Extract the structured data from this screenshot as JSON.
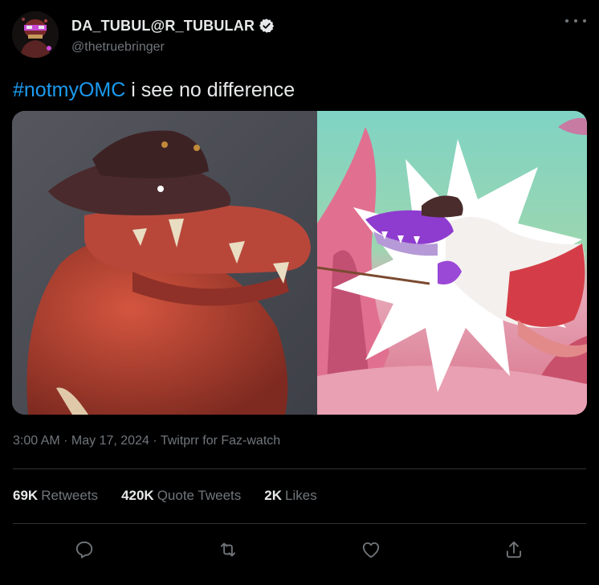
{
  "author": {
    "display_name": "DA_TUBUL@R_TUBULAR",
    "handle": "@thetruebringer",
    "verified": true
  },
  "tweet": {
    "hashtag": "#notmyOMC",
    "text": " i see no difference"
  },
  "meta": {
    "time": "3:00 AM",
    "separator1": " · ",
    "date": "May 17, 2024",
    "separator2": " · ",
    "source": "Twitprr for Faz-watch"
  },
  "stats": [
    {
      "value": "69K",
      "label": "Retweets"
    },
    {
      "value": "420K",
      "label": "Quote Tweets"
    },
    {
      "value": "2K",
      "label": "Likes"
    }
  ],
  "actions": [
    {
      "icon": "reply-icon"
    },
    {
      "icon": "retweet-icon"
    },
    {
      "icon": "like-icon"
    },
    {
      "icon": "share-icon"
    }
  ],
  "colors": {
    "background": "#000000",
    "text_primary": "#e7e9ea",
    "text_secondary": "#71767b",
    "accent": "#1d9bf0",
    "divider": "#2f3336"
  }
}
